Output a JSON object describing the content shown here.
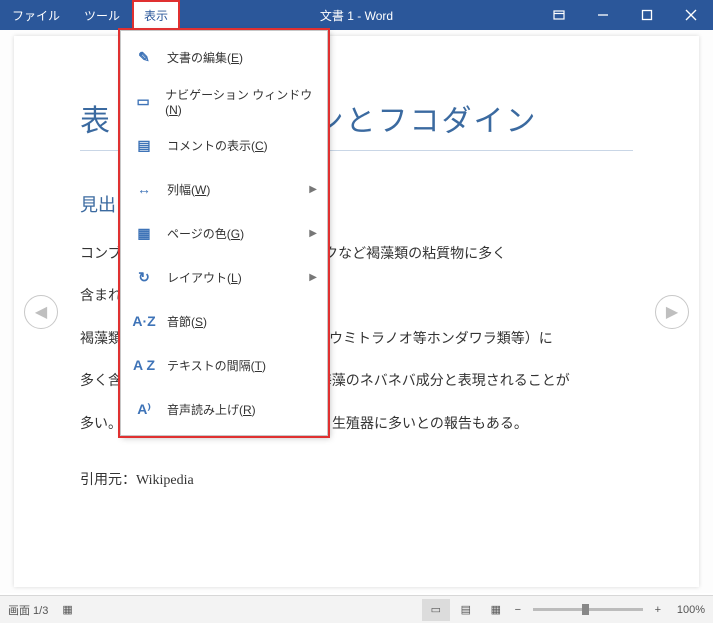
{
  "title": "文書 1  -  Word",
  "menu": {
    "file": "ファイル",
    "tools": "ツール",
    "view": "表示"
  },
  "dropdown": [
    {
      "label": "文書の編集(",
      "accel": "E",
      "tail": ")",
      "sub": false
    },
    {
      "label": "ナビゲーション ウィンドウ(",
      "accel": "N",
      "tail": ")",
      "sub": false
    },
    {
      "label": "コメントの表示(",
      "accel": "C",
      "tail": ")",
      "sub": false
    },
    {
      "label": "列幅(",
      "accel": "W",
      "tail": ")",
      "sub": true
    },
    {
      "label": "ページの色(",
      "accel": "G",
      "tail": ")",
      "sub": true
    },
    {
      "label": "レイアウト(",
      "accel": "L",
      "tail": ")",
      "sub": true
    },
    {
      "label": "音節(",
      "accel": "S",
      "tail": ")",
      "sub": false
    },
    {
      "label": "テキストの間隔(",
      "accel": "T",
      "tail": ")",
      "sub": false
    },
    {
      "label": "音声読み上げ(",
      "accel": "R",
      "tail": ")",
      "sub": false
    }
  ],
  "icons": [
    "edit-doc-icon",
    "nav-pane-icon",
    "comments-icon",
    "column-width-icon",
    "page-color-icon",
    "layout-icon",
    "syllable-icon",
    "text-spacing-icon",
    "read-aloud-icon"
  ],
  "icon_glyph": [
    "✎",
    "▭",
    "▤",
    "↔",
    "▦",
    "↻",
    "A·Z",
    "A Z",
    "A⁾"
  ],
  "doc": {
    "title": "表 フコキサンチンとフコダイン",
    "h2": "見出し",
    "p1": "コンブ、ワカメ（メカブを含む）、モズクなど褐藻類の粘質物に多く",
    "p2": "含まれる食物繊維である。",
    "p3": "褐藻類（モズク、ヒバマタ、アカモク、ウミトラノオ等ホンダワラ類等）に",
    "p4": "多く含まれ、わかりやすい表現として海藻のネバネバ成分と表現されることが",
    "p5": "多い。アカモクに関する研究などから、生殖器に多いとの報告もある。",
    "p6": "引用元：Wikipedia"
  },
  "status": {
    "page": "画面 1/3",
    "zoom": "100%"
  }
}
